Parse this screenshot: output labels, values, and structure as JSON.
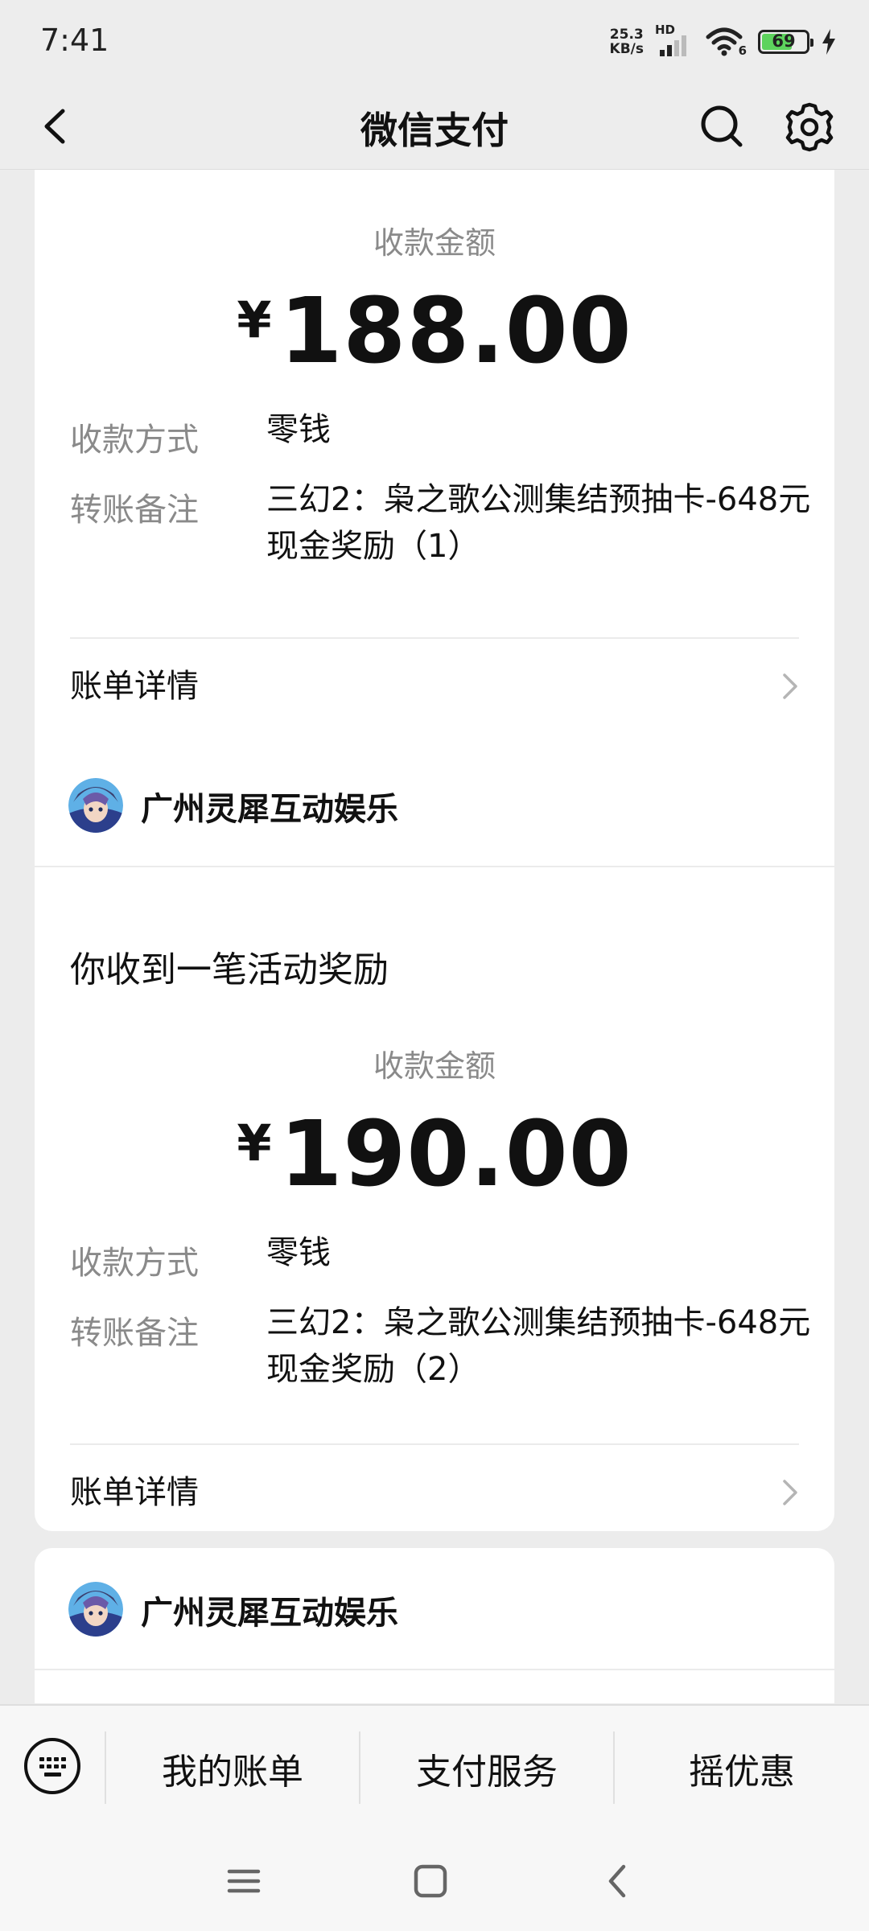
{
  "status_bar": {
    "time": "7:41",
    "net_speed_value": "25.3",
    "net_speed_unit": "KB/s",
    "network_tag": "HD",
    "wifi_tag": "6",
    "battery_level": "69",
    "battery_fraction": 0.69
  },
  "header": {
    "title": "微信支付"
  },
  "cards": [
    {
      "amount_label": "收款金额",
      "currency": "¥",
      "amount": "188.00",
      "method_label": "收款方式",
      "method_value": "零钱",
      "note_label": "转账备注",
      "note_value": "三幻2：枭之歌公测集结预抽卡-648元现金奖励（1）",
      "detail_link": "账单详情"
    },
    {
      "merchant": "广州灵犀互动娱乐",
      "title": "你收到一笔活动奖励",
      "amount_label": "收款金额",
      "currency": "¥",
      "amount": "190.00",
      "method_label": "收款方式",
      "method_value": "零钱",
      "note_label": "转账备注",
      "note_value": "三幻2：枭之歌公测集结预抽卡-648元现金奖励（2）",
      "detail_link": "账单详情"
    },
    {
      "merchant": "广州灵犀互动娱乐"
    }
  ],
  "bottom_menu": {
    "items": [
      "我的账单",
      "支付服务",
      "摇优惠"
    ]
  },
  "colors": {
    "background": "#ececec",
    "card": "#ffffff",
    "muted_text": "#8a8a8a",
    "battery_fill": "#5dd35d"
  },
  "icons": [
    "back-arrow-icon",
    "search-icon",
    "gear-icon",
    "chevron-right-icon",
    "keyboard-icon",
    "menu-lines-icon",
    "home-square-icon",
    "nav-back-icon",
    "wifi-icon",
    "signal-icon",
    "charging-bolt-icon"
  ]
}
